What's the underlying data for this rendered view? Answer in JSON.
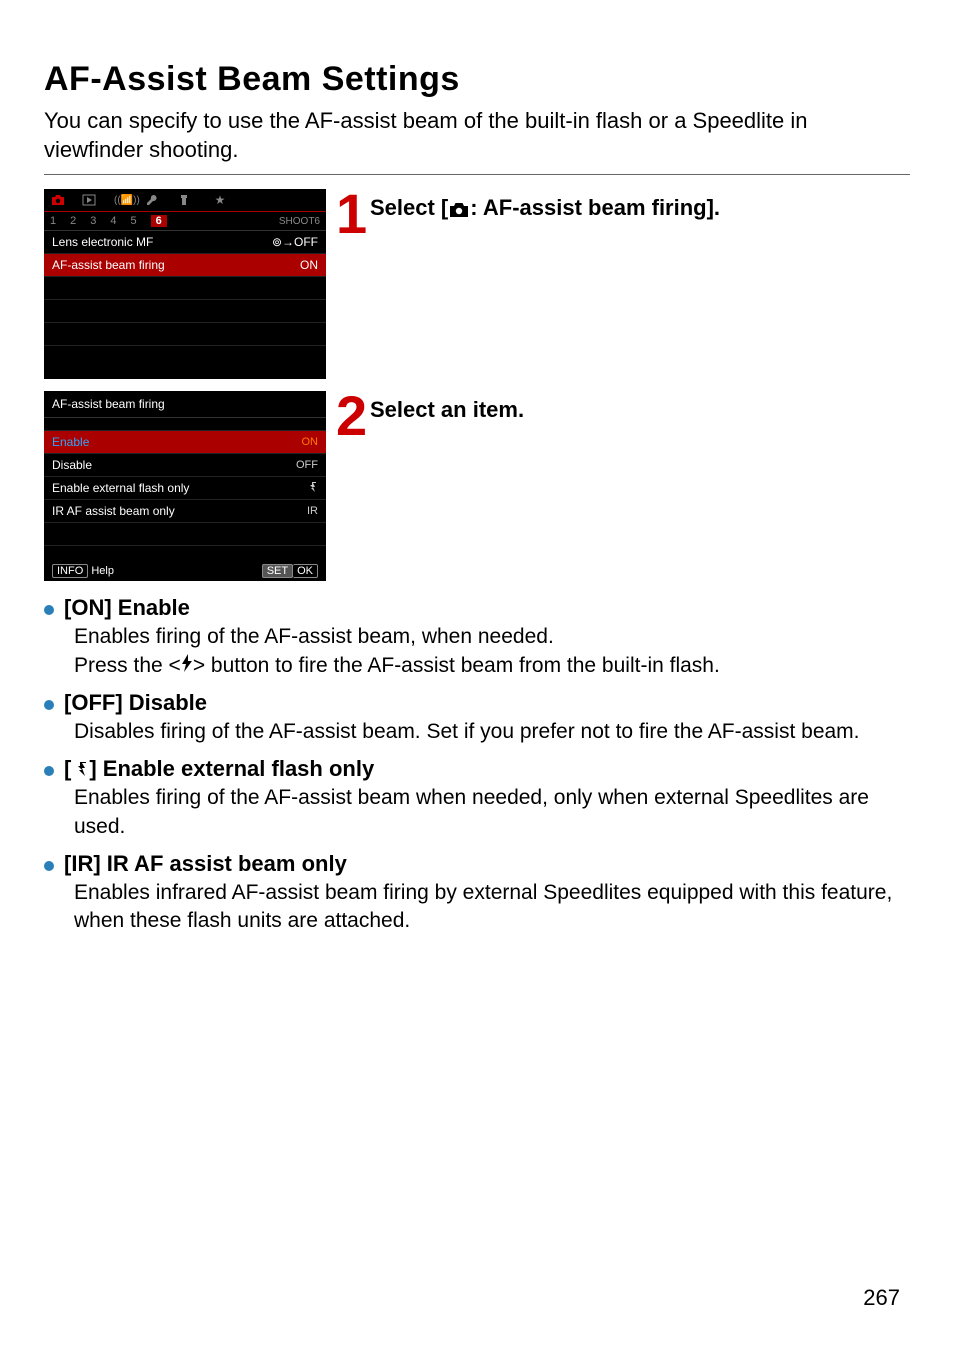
{
  "title": "AF-Assist Beam Settings",
  "intro": "You can specify to use the AF-assist beam of the built-in flash or a Speedlite in viewfinder shooting.",
  "screen1": {
    "subtabs": [
      "1",
      "2",
      "3",
      "4",
      "5",
      "6"
    ],
    "subtab_selected": "6",
    "shoot_label": "SHOOT6",
    "rows": [
      {
        "label": "Lens electronic MF",
        "value": "⊚→OFF"
      },
      {
        "label": "AF-assist beam firing",
        "value": "ON",
        "selected": true
      }
    ]
  },
  "screen2": {
    "title": "AF-assist beam firing",
    "options": [
      {
        "label": "Enable",
        "value": "ON",
        "selected": true
      },
      {
        "label": "Disable",
        "value": "OFF"
      },
      {
        "label": "Enable external flash only",
        "value": "ext-icon"
      },
      {
        "label": "IR AF assist beam only",
        "value": "IR"
      }
    ],
    "footer_left_a": "INFO",
    "footer_left_b": "Help",
    "footer_right_a": "SET",
    "footer_right_b": "OK"
  },
  "step1": {
    "num": "1",
    "text_a": "Select [",
    "text_b": ": AF-assist beam firing]."
  },
  "step2": {
    "num": "2",
    "text": "Select an item."
  },
  "bullets": [
    {
      "head": "[ON] Enable",
      "body_a": "Enables firing of the AF-assist beam, when needed.",
      "body_b_pre": "Press the <",
      "body_b_post": "> button to fire the AF-assist beam from the built-in flash."
    },
    {
      "head": "[OFF] Disable",
      "body": "Disables firing of the AF-assist beam. Set if you prefer not to fire the AF-assist beam."
    },
    {
      "head_pre": "[",
      "head_post": "] Enable external flash only",
      "body": "Enables firing of the AF-assist beam when needed, only when external Speedlites are used."
    },
    {
      "head": "[IR] IR AF assist beam only",
      "body": "Enables infrared AF-assist beam firing by external Speedlites equipped with this feature, when these flash units are attached."
    }
  ],
  "page_number": "267"
}
